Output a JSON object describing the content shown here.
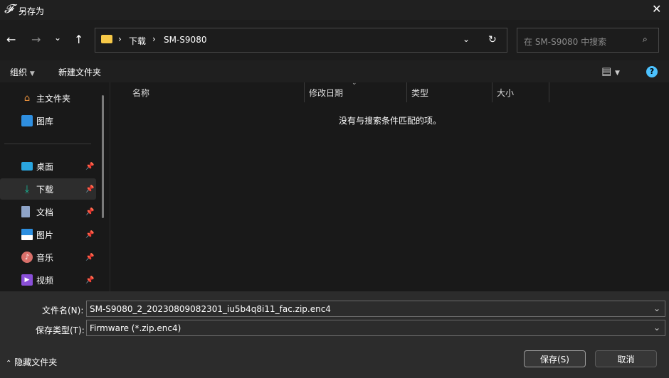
{
  "window": {
    "title": "另存为",
    "app_icon": "script-f-logo"
  },
  "nav": {
    "path": [
      "下载",
      "SM-S9080"
    ],
    "search_placeholder": "在 SM-S9080 中搜索"
  },
  "toolbar": {
    "organize": "组织",
    "new_folder": "新建文件夹"
  },
  "sidebar": {
    "top": [
      {
        "label": "主文件夹",
        "icon": "home-icon"
      },
      {
        "label": "图库",
        "icon": "gallery-icon"
      }
    ],
    "pinned": [
      {
        "label": "桌面",
        "icon": "desktop-icon"
      },
      {
        "label": "下载",
        "icon": "download-icon",
        "selected": true
      },
      {
        "label": "文档",
        "icon": "document-icon"
      },
      {
        "label": "图片",
        "icon": "pictures-icon"
      },
      {
        "label": "音乐",
        "icon": "music-icon"
      },
      {
        "label": "视频",
        "icon": "video-icon"
      }
    ]
  },
  "columns": [
    "名称",
    "修改日期",
    "类型",
    "大小"
  ],
  "empty_message": "没有与搜索条件匹配的项。",
  "form": {
    "filename_label": "文件名(N):",
    "filename_value": "SM-S9080_2_20230809082301_iu5b4q8i11_fac.zip.enc4",
    "type_label": "保存类型(T):",
    "type_value": "Firmware (*.zip.enc4)"
  },
  "footer": {
    "hide_folders": "隐藏文件夹",
    "save": "保存(S)",
    "cancel": "取消"
  },
  "colors": {
    "accent": "#4cc2ff",
    "folder": "#f7c948",
    "download": "#1ab394"
  }
}
